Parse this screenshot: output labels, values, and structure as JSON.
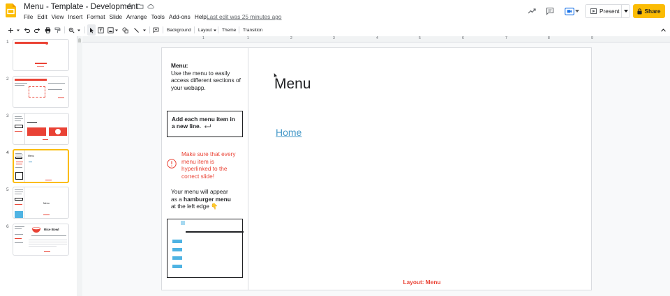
{
  "app": {
    "title": "Menu - Template - Development",
    "last_edit": "Last edit was 25 minutes ago",
    "menu": [
      "File",
      "Edit",
      "View",
      "Insert",
      "Format",
      "Slide",
      "Arrange",
      "Tools",
      "Add-ons",
      "Help"
    ],
    "present_label": "Present",
    "share_label": "Share"
  },
  "toolbar": {
    "background_label": "Background",
    "layout_label": "Layout",
    "theme_label": "Theme",
    "transition_label": "Transition"
  },
  "ruler": {
    "marks": [
      "1",
      "1",
      "2",
      "3",
      "4",
      "5",
      "6",
      "7",
      "8",
      "9"
    ]
  },
  "filmstrip": {
    "slides": [
      "1",
      "2",
      "3",
      "4",
      "5",
      "6"
    ],
    "active_index": 4,
    "thumb_texts": {
      "slide4_title": "Menu",
      "slide5_title": "Menu",
      "slide6_title": "Rice Bowl"
    }
  },
  "slide": {
    "panel_heading": "Menu:",
    "panel_body": "Use the menu to easily access different sections of your webapp.",
    "box_text_line1": "Add each menu item in",
    "box_text_line2": "a new line.",
    "warning": "Make sure that every menu item is hyperlinked to the correct slide!",
    "hamburger_line1": "Your menu will appear",
    "hamburger_line2_prefix": "as a ",
    "hamburger_line2_bold": "hamburger menu",
    "hamburger_line3": "at the left edge 👇",
    "title": "Menu",
    "link": "Home",
    "layout_label": "Layout: Menu"
  },
  "colors": {
    "brand_yellow": "#fbbc04",
    "accent_red": "#ea4335",
    "link_blue": "#4699c8",
    "mock_bar_blue": "#4fb3e3"
  }
}
